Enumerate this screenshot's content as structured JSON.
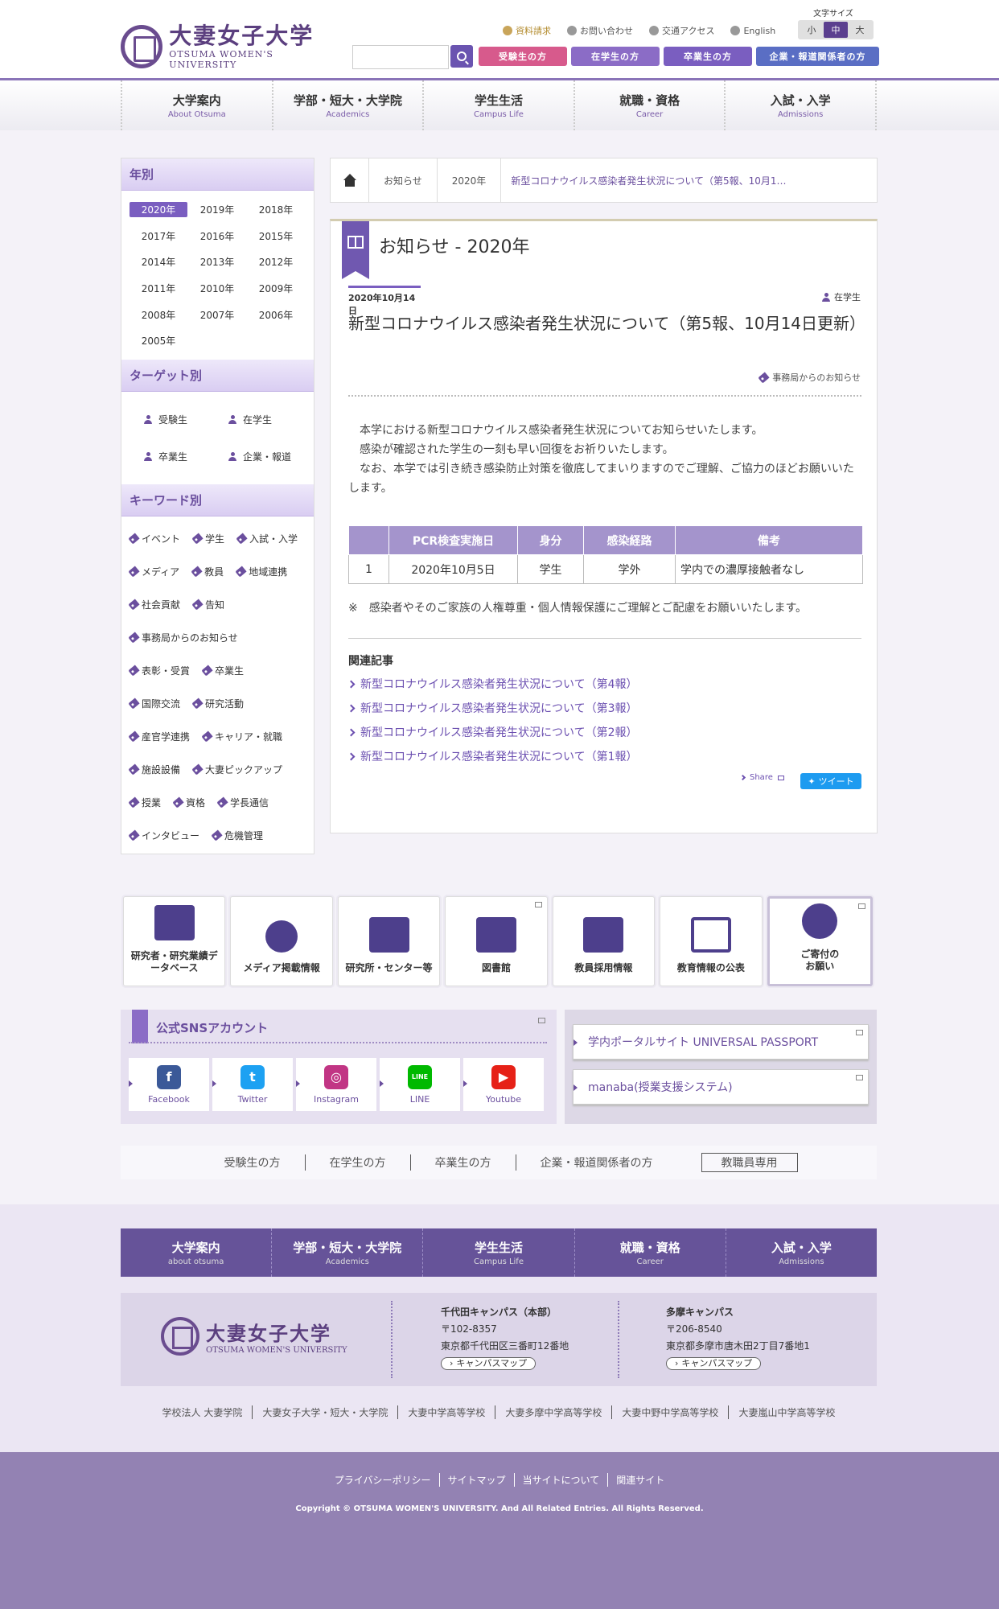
{
  "header": {
    "logo_jp": "大妻女子大学",
    "logo_en": "OTSUMA WOMEN'S UNIVERSITY",
    "utility": [
      "資料請求",
      "お問い合わせ",
      "交通アクセス",
      "English"
    ],
    "fontsize_label": "文字サイズ",
    "fontsize": [
      "小",
      "中",
      "大"
    ],
    "search_placeholder": "",
    "audience": [
      "受験生の方",
      "在学生の方",
      "卒業生の方",
      "企業・報道関係者の方"
    ]
  },
  "gnav": [
    {
      "jp": "大学案内",
      "en": "About Otsuma"
    },
    {
      "jp": "学部・短大・大学院",
      "en": "Academics"
    },
    {
      "jp": "学生生活",
      "en": "Campus Life"
    },
    {
      "jp": "就職・資格",
      "en": "Career"
    },
    {
      "jp": "入試・入学",
      "en": "Admissions"
    }
  ],
  "sidebar": {
    "year_title": "年別",
    "years": [
      "2020年",
      "2019年",
      "2018年",
      "2017年",
      "2016年",
      "2015年",
      "2014年",
      "2013年",
      "2012年",
      "2011年",
      "2010年",
      "2009年",
      "2008年",
      "2007年",
      "2006年",
      "2005年"
    ],
    "target_title": "ターゲット別",
    "targets": [
      "受験生",
      "在学生",
      "卒業生",
      "企業・報道"
    ],
    "keyword_title": "キーワード別",
    "keywords": [
      "イベント",
      "学生",
      "入試・入学",
      "メディア",
      "教員",
      "地域連携",
      "社会貢献",
      "告知",
      "事務局からのお知らせ",
      "表彰・受賞",
      "卒業生",
      "国際交流",
      "研究活動",
      "産官学連携",
      "キャリア・就職",
      "施設設備",
      "大妻ピックアップ",
      "授業",
      "資格",
      "学長通信",
      "インタビュー",
      "危機管理"
    ]
  },
  "breadcrumb": [
    "お知らせ",
    "2020年",
    "新型コロナウイルス感染者発生状況について（第5報、10月1…"
  ],
  "article": {
    "section_title": "お知らせ - 2020年",
    "date": "2020年10月14日",
    "target": "在学生",
    "heading": "新型コロナウイルス感染者発生状況について（第5報、10月14日更新）",
    "category": "事務局からのお知らせ",
    "body": [
      "本学における新型コロナウイルス感染者発生状況についてお知らせいたします。",
      "感染が確認された学生の一刻も早い回復をお祈りいたします。",
      "なお、本学では引き続き感染防止対策を徹底してまいりますのでご理解、ご協力のほどお願いいたします。"
    ],
    "table": {
      "headers": [
        "",
        "PCR検査実施日",
        "身分",
        "感染経路",
        "備考"
      ],
      "rows": [
        [
          "1",
          "2020年10月5日",
          "学生",
          "学外",
          "学内での濃厚接触者なし"
        ]
      ]
    },
    "note": "※　感染者やそのご家族の人権尊重・個人情報保護にご理解とご配慮をお願いいたします。",
    "related_title": "関連記事",
    "related": [
      "新型コロナウイルス感染者発生状況について（第4報）",
      "新型コロナウイルス感染者発生状況について（第3報）",
      "新型コロナウイルス感染者発生状況について（第2報）",
      "新型コロナウイルス感染者発生状況について（第1報）"
    ],
    "share": "Share",
    "tweet": "ツイート"
  },
  "banners": [
    "研究者・研究業績データベース",
    "メディア掲載情報",
    "研究所・センター等",
    "図書館",
    "教員採用情報",
    "教育情報の公表",
    "ご寄付のお願い"
  ],
  "sns": {
    "title": "公式SNSアカウント",
    "items": [
      {
        "label": "Facebook",
        "glyph": "f",
        "color": "#3b5998"
      },
      {
        "label": "Twitter",
        "glyph": "t",
        "color": "#1da1f2"
      },
      {
        "label": "Instagram",
        "glyph": "◎",
        "color": "#c13584"
      },
      {
        "label": "LINE",
        "glyph": "LINE",
        "color": "#00b900"
      },
      {
        "label": "Youtube",
        "glyph": "▶",
        "color": "#e62117"
      }
    ]
  },
  "portal": [
    "学内ポータルサイト UNIVERSAL PASSPORT",
    "manaba(授業支援システム)"
  ],
  "audbar": [
    "受験生の方",
    "在学生の方",
    "卒業生の方",
    "企業・報道関係者の方",
    "教職員専用"
  ],
  "footer": {
    "nav": [
      {
        "jp": "大学案内",
        "en": "about otsuma"
      },
      {
        "jp": "学部・短大・大学院",
        "en": "Academics"
      },
      {
        "jp": "学生生活",
        "en": "Campus Life"
      },
      {
        "jp": "就職・資格",
        "en": "Career"
      },
      {
        "jp": "入試・入学",
        "en": "Admissions"
      }
    ],
    "logo_jp": "大妻女子大学",
    "logo_en": "OTSUMA WOMEN'S UNIVERSITY",
    "campus1": {
      "name": "千代田キャンパス（本部）",
      "zip": "〒102-8357",
      "addr": "東京都千代田区三番町12番地",
      "map": "キャンパスマップ"
    },
    "campus2": {
      "name": "多摩キャンパス",
      "zip": "〒206-8540",
      "addr": "東京都多摩市唐木田2丁目7番地1",
      "map": "キャンパスマップ"
    },
    "schools": [
      "学校法人 大妻学院",
      "大妻女子大学・短大・大学院",
      "大妻中学高等学校",
      "大妻多摩中学高等学校",
      "大妻中野中学高等学校",
      "大妻嵐山中学高等学校"
    ],
    "links": [
      "プライバシーポリシー",
      "サイトマップ",
      "当サイトについて",
      "関連サイト"
    ],
    "copyright": "Copyright © OTSUMA WOMEN'S UNIVERSITY. And All Related Entries. All Rights Reserved."
  }
}
